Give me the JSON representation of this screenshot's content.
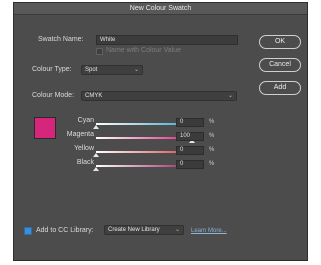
{
  "dialog": {
    "title": "New Colour Swatch"
  },
  "form": {
    "swatch_name_label": "Swatch Name:",
    "swatch_name_value": "White",
    "name_with_value_label": "Name with Colour Value",
    "colour_type_label": "Colour Type:",
    "colour_type_value": "Spot",
    "colour_mode_label": "Colour Mode:",
    "colour_mode_value": "CMYK"
  },
  "buttons": {
    "ok": "OK",
    "cancel": "Cancel",
    "add": "Add"
  },
  "swatch_color": "#d6257c",
  "sliders": [
    {
      "label": "Cyan",
      "value": "0",
      "unit": "%",
      "fraction": 0.0,
      "color": "#3aa7c9"
    },
    {
      "label": "Magenta",
      "value": "100",
      "unit": "%",
      "fraction": 1.0,
      "color": "#d6257c"
    },
    {
      "label": "Yellow",
      "value": "0",
      "unit": "%",
      "fraction": 0.0,
      "color": "#d94a4a"
    },
    {
      "label": "Black",
      "value": "0",
      "unit": "%",
      "fraction": 0.0,
      "color": "#a2205f"
    }
  ],
  "footer": {
    "add_to_library_label": "Add to CC Library:",
    "library_value": "Create New Library",
    "learn_more": "Learn More..."
  }
}
